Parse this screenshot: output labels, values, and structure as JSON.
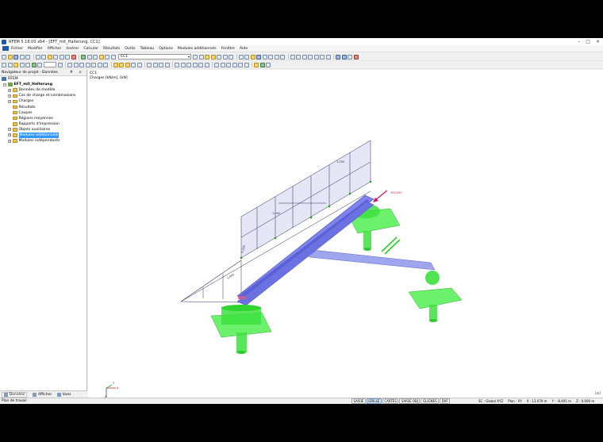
{
  "window": {
    "title": "RFEM 5.18.00 x64 - [EFT_mit_Halterung, CC1]",
    "controls": [
      "–",
      "□",
      "×"
    ]
  },
  "menu": [
    "Fichier",
    "Modifier",
    "Afficher",
    "Insérer",
    "Calculer",
    "Résultats",
    "Outils",
    "Tableau",
    "Options",
    "Modules additionnels",
    "Fenêtre",
    "Aide"
  ],
  "toolbar": {
    "loadcase": "CC1"
  },
  "navigator": {
    "header": "Navigateur de projet - Données",
    "header_controls": "# ×",
    "root": "RFEM",
    "project": "EFT_mit_Halterung",
    "items": [
      {
        "label": "Données de modèle",
        "expand": true
      },
      {
        "label": "Cas de charge et combinaisons",
        "expand": true
      },
      {
        "label": "Charges",
        "expand": true
      },
      {
        "label": "Résultats",
        "expand": false
      },
      {
        "label": "Coupes",
        "expand": false
      },
      {
        "label": "Régions moyennes",
        "expand": false
      },
      {
        "label": "Rapports d'impression",
        "expand": false
      },
      {
        "label": "Objets auxiliaires",
        "expand": true
      },
      {
        "label": "Modules additionnels",
        "expand": true,
        "selected": true
      },
      {
        "label": "Modules indépendants",
        "expand": true
      }
    ],
    "tabs": [
      "Données",
      "Afficher",
      "Vues"
    ]
  },
  "viewport": {
    "label_lc": "CC1",
    "label_units": "Charges [kN/m], [kN]",
    "load_values": [
      "1.000",
      "1.000",
      "5.000",
      "500.000"
    ],
    "dimension": "3.000",
    "axis_labels": [
      "X",
      "Y",
      "Z"
    ],
    "corner": "[m]"
  },
  "colors": {
    "beam": "#6b6fe0",
    "support": "#38e03a",
    "load_line": "#2a2a5a",
    "load_arrow": "#c4185c"
  },
  "statusbar": {
    "left": "Plan de travail",
    "buttons": [
      {
        "label": "SAISIE",
        "on": false
      },
      {
        "label": "GRILLE",
        "on": true
      },
      {
        "label": "CARTES",
        "on": false
      },
      {
        "label": "SAISIE OBJ",
        "on": false
      },
      {
        "label": "GLIGNES",
        "on": false
      },
      {
        "label": "DXF",
        "on": false
      }
    ],
    "sc": "SC : Global XYZ",
    "plan": "Plan : XY",
    "x": "X : 13.079 m",
    "y": "Y : -8.405 m",
    "z": "Z : 0.000 m"
  }
}
